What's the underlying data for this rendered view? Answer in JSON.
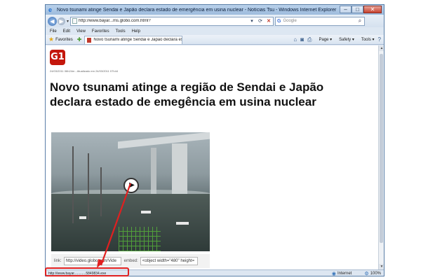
{
  "window": {
    "title": "Novo tsunami atinge Sendai e Japão declara estado de emergência em usina nuclear - Notícias Tsu - Windows Internet Explorer",
    "buttons": {
      "minimize": "–",
      "maximize": "□",
      "close": "✕"
    }
  },
  "address_bar": {
    "url": "http://www.bayar...ms.globo.com.html?",
    "search_placeholder": "Google"
  },
  "menu": [
    "File",
    "Edit",
    "View",
    "Favorites",
    "Tools",
    "Help"
  ],
  "favorites_bar": {
    "favorites_label": "Favorites",
    "tab_title": "Novo tsunami atinge Sendai e Japão declara estado d...",
    "commands": [
      "Page",
      "Safety",
      "Tools"
    ]
  },
  "page": {
    "logo": "G1",
    "dateline": "24/03/2011 06h24m - Atualizado em 24/03/2011 07h44",
    "headline": "Novo tsunami atinge a região de Sendai e Japão declara estado de emegência em usina nuclear",
    "embed": {
      "link_label": "link:",
      "link_value": "http://video.globo.com/Vide",
      "embed_label": "embed:",
      "embed_value": "<object width=\"480\" height="
    }
  },
  "status_bar": {
    "url": "http://www.bayar............5849834.exe",
    "zone": "Internet",
    "zoom": "100%"
  },
  "annotation": {
    "color": "#e02020"
  }
}
